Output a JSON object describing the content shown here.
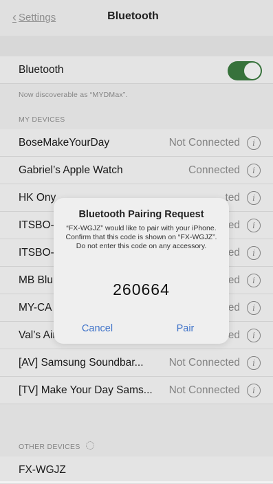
{
  "nav": {
    "back_label": "Settings",
    "title": "Bluetooth"
  },
  "bluetooth_toggle": {
    "label": "Bluetooth",
    "state": "on",
    "color": "#3b7a3f"
  },
  "discoverable_note": "Now discoverable as “MYDMax”.",
  "my_devices": {
    "header": "MY DEVICES",
    "items": [
      {
        "name": "BoseMakeYourDay",
        "status": "Not Connected"
      },
      {
        "name": "Gabriel’s Apple Watch",
        "status": "Connected"
      },
      {
        "name": "HK Ony",
        "status": "ted"
      },
      {
        "name": "ITSBO-",
        "status": "ed"
      },
      {
        "name": "ITSBO-",
        "status": "ed"
      },
      {
        "name": "MB Blu",
        "status": "ed"
      },
      {
        "name": "MY-CA",
        "status": "ed"
      },
      {
        "name": "Val’s Air",
        "status": "Not Connected"
      },
      {
        "name": "[AV] Samsung Soundbar...",
        "status": "Not Connected"
      },
      {
        "name": "[TV] Make Your Day Sams...",
        "status": "Not Connected"
      }
    ]
  },
  "other_devices": {
    "header": "OTHER DEVICES",
    "items": [
      {
        "name": "FX-WGJZ"
      }
    ]
  },
  "alert": {
    "title": "Bluetooth Pairing Request",
    "message": "“FX-WGJZ” would like to pair with your iPhone. Confirm that this code is shown on “FX-WGJZ”. Do not enter this code on any accessory.",
    "code": "260664",
    "cancel_label": "Cancel",
    "pair_label": "Pair",
    "accent": "#3f73c9"
  }
}
